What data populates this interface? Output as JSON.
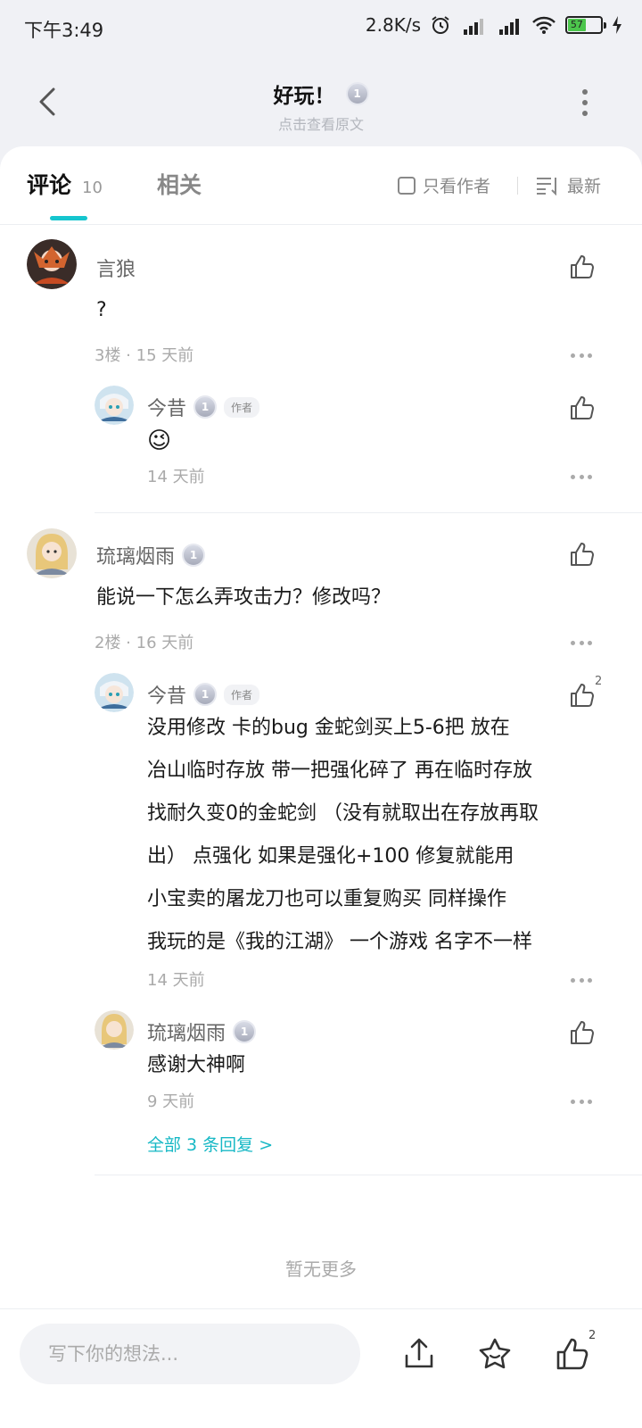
{
  "status_bar": {
    "time": "下午3:49",
    "net_speed": "2.8K/s",
    "battery": "57",
    "icons": [
      "alarm-icon",
      "signal-hd-icon",
      "signal-hd-icon",
      "wifi-icon",
      "battery-icon",
      "charging-icon"
    ]
  },
  "header": {
    "title": "好玩！",
    "level_badge": "1",
    "subtitle": "点击查看原文",
    "icons": [
      "back-arrow-icon",
      "more-vertical-icon"
    ]
  },
  "tabs": {
    "comment_label": "评论",
    "comment_count": "10",
    "related_label": "相关",
    "author_only_label": "只看作者",
    "sort_label": "最新"
  },
  "comments": [
    {
      "name": "言狼",
      "text": "?",
      "meta": "3楼 · 15 天前",
      "replies": [
        {
          "name": "今昔",
          "level": "1",
          "author_badge": "作者",
          "text": "😉",
          "meta": "14 天前"
        }
      ]
    },
    {
      "name": "琉璃烟雨",
      "level": "1",
      "text": "能说一下怎么弄攻击力？修改吗？",
      "meta": "2楼 · 16 天前",
      "replies": [
        {
          "name": "今昔",
          "level": "1",
          "author_badge": "作者",
          "like_count": "2",
          "lines": [
            "没用修改  卡的bug  金蛇剑买上5-6把  放在",
            "冶山临时存放 带一把强化碎了 再在临时存放",
            "找耐久变0的金蛇剑 （没有就取出在存放再取",
            "出） 点强化 如果是强化+100 修复就能用",
            "小宝卖的屠龙刀也可以重复购买 同样操作",
            "我玩的是《我的江湖》 一个游戏 名字不一样"
          ],
          "meta": "14 天前"
        },
        {
          "name": "琉璃烟雨",
          "level": "1",
          "text": "感谢大神啊",
          "meta": "9 天前"
        }
      ],
      "more_replies": "全部 3 条回复 >"
    }
  ],
  "footer": {
    "no_more": "暂无更多"
  },
  "bottom_bar": {
    "input_placeholder": "写下你的想法...",
    "like_count": "2",
    "icons": [
      "share-icon",
      "star-icon",
      "like-icon"
    ]
  },
  "colors": {
    "accent": "#15c5ce",
    "link": "#17b8c5",
    "background": "#f0f1f5"
  }
}
